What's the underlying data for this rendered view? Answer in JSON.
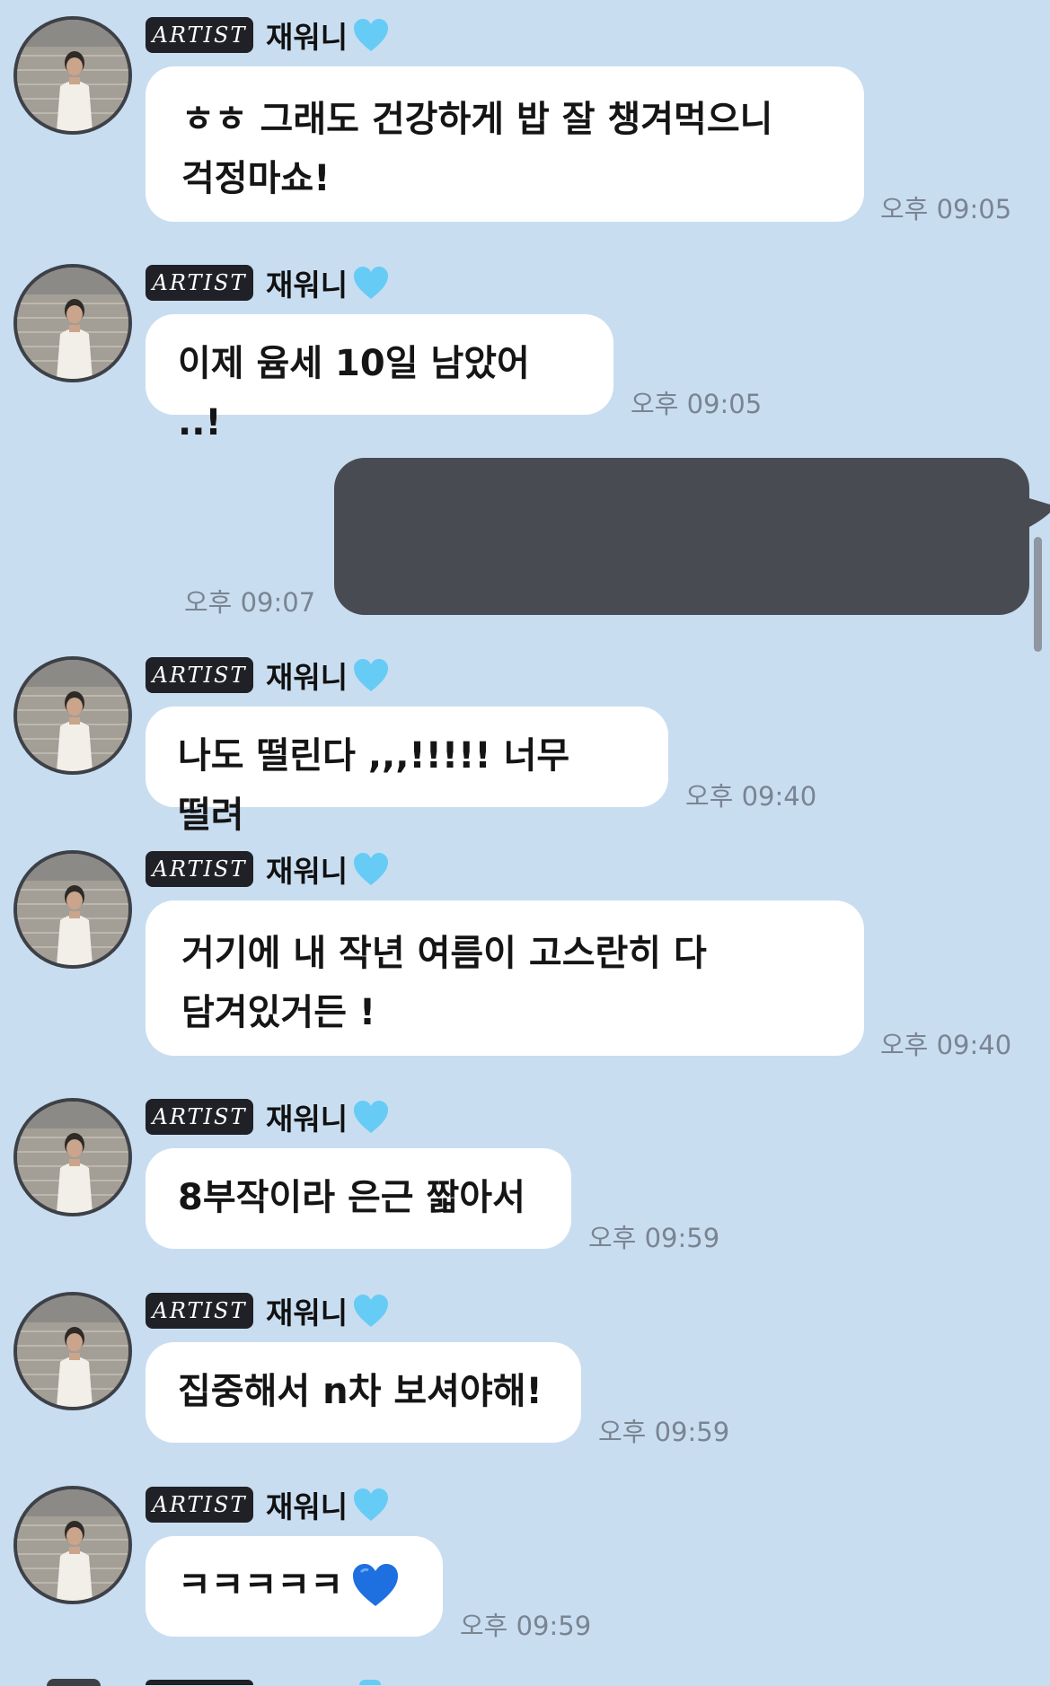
{
  "sender": {
    "badge": "ARTIST",
    "name": "재워니"
  },
  "colors": {
    "background": "#c9ddf1",
    "received_bubble": "#ffffff",
    "sent_bubble": "#484c52",
    "badge": "#1f2126",
    "heart_light": "#66ccf5",
    "heart_dark": "#1e6fe0"
  },
  "messages": [
    {
      "text": "ㅎㅎ 그래도 건강하게 밥 잘 챙겨먹으니 걱정마쇼!",
      "time": "오후 09:05"
    },
    {
      "text": "이제 윰세 10일 남았어 ..!",
      "time": "오후 09:05"
    },
    {
      "text": "나도 떨린다 ,,,!!!!! 너무 떨려",
      "time": "오후 09:40"
    },
    {
      "text": "거기에 내 작년 여름이 고스란히 다 담겨있거든 !",
      "time": "오후 09:40"
    },
    {
      "text": "8부작이라 은근 짧아서",
      "time": "오후 09:59"
    },
    {
      "text": "집중해서 n차 보셔야해!",
      "time": "오후 09:59"
    },
    {
      "text": "ㅋㅋㅋㅋㅋ",
      "time": "오후 09:59"
    }
  ],
  "sent": {
    "time": "오후 09:07",
    "redacted": true
  },
  "icons": {
    "name_heart": "light-blue-heart-icon",
    "message_heart": "blue-heart-icon"
  }
}
